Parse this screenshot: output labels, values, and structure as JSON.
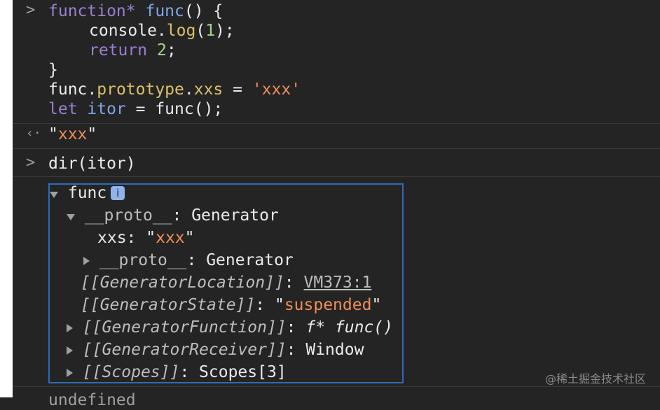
{
  "prompt_symbol": ">",
  "result_symbol": "‹·",
  "input1": {
    "l1_kw": "function*",
    "l1_fn": "func",
    "l1_rest": "() {",
    "l2_a": "console.",
    "l2_log": "log",
    "l2_b": "(",
    "l2_num": "1",
    "l2_c": ");",
    "l3_kw": "return",
    "l3_num": "2",
    "l3_c": ";",
    "l4": "}",
    "l5_a": "func.",
    "l5_proto": "prototype",
    "l5_dot": ".",
    "l5_xxs": "xxs",
    "l5_eq": " = ",
    "l5_str": "'xxx'",
    "l6_kw": "let",
    "l6_var": "itor",
    "l6_rest": " = func();"
  },
  "output1": {
    "q1": "\"",
    "val": "xxx",
    "q2": "\""
  },
  "input2": {
    "text": "dir(itor)"
  },
  "object": {
    "root_label": "func",
    "info_badge": "i",
    "proto_key": "__proto__",
    "proto_sep": ": ",
    "proto_val": "Generator",
    "xxs_key": "xxs",
    "xxs_sep": ": ",
    "xxs_q1": "\"",
    "xxs_val": "xxx",
    "xxs_q2": "\"",
    "proto2_key": "__proto__",
    "proto2_sep": ": ",
    "proto2_val": "Generator",
    "loc_key": "[[GeneratorLocation]]",
    "loc_sep": ": ",
    "loc_val": "VM373:1",
    "state_key": "[[GeneratorState]]",
    "state_sep": ": ",
    "state_q1": "\"",
    "state_val": "suspended",
    "state_q2": "\"",
    "fn_key": "[[GeneratorFunction]]",
    "fn_sep": ": ",
    "fn_val": "f* func()",
    "recv_key": "[[GeneratorReceiver]]",
    "recv_sep": ": ",
    "recv_val": "Window",
    "scopes_key": "[[Scopes]]",
    "scopes_sep": ": ",
    "scopes_val": "Scopes[3]"
  },
  "bottom_partial": "undefined",
  "watermark": "@稀土掘金技术社区"
}
